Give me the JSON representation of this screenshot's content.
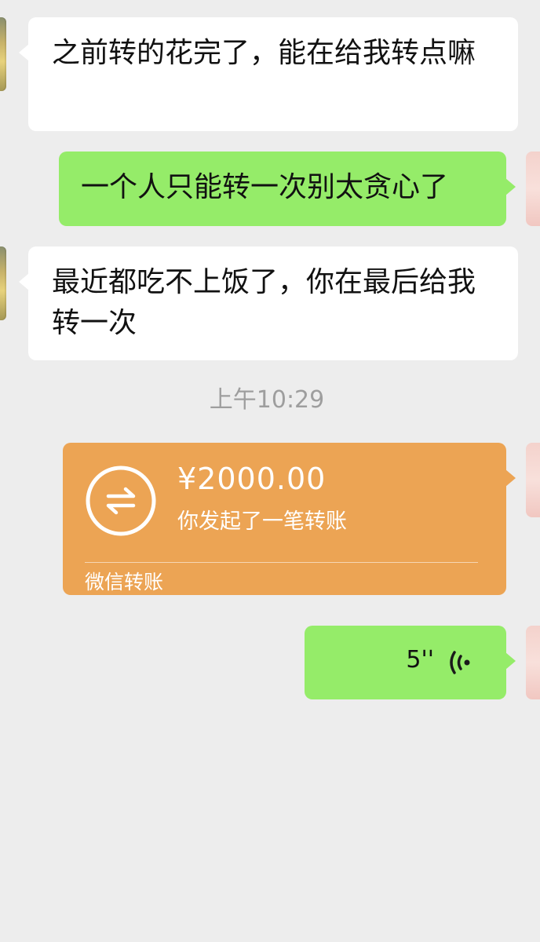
{
  "messages": [
    {
      "side": "left",
      "text": "之前转的花完了，能在给我转点嘛"
    },
    {
      "side": "right",
      "text": "一个人只能转一次别太贪心了"
    },
    {
      "side": "left",
      "text": "最近都吃不上饭了，你在最后给我转一次"
    }
  ],
  "time_label": "上午10:29",
  "transfer": {
    "amount": "¥2000.00",
    "description": "你发起了一笔转账",
    "footer": "微信转账",
    "icon": "transfer-arrows-icon",
    "color": "#eca454"
  },
  "voice": {
    "duration": "5''",
    "icon": "voice-waves-icon"
  },
  "colors": {
    "background": "#ededed",
    "incoming_bubble": "#ffffff",
    "outgoing_bubble": "#95ec69"
  }
}
